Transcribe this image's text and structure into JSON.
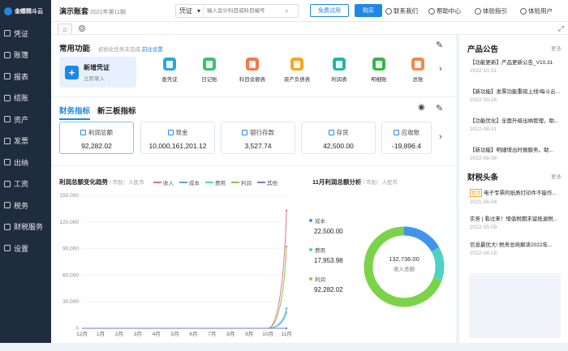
{
  "brand": {
    "name": "金蝶精斗云"
  },
  "sidebar": {
    "items": [
      {
        "label": "凭证",
        "icon": "voucher-icon"
      },
      {
        "label": "账簿",
        "icon": "ledger-icon"
      },
      {
        "label": "报表",
        "icon": "report-icon"
      },
      {
        "label": "结账",
        "icon": "closing-icon"
      },
      {
        "label": "资产",
        "icon": "asset-icon"
      },
      {
        "label": "发票",
        "icon": "invoice-icon"
      },
      {
        "label": "出纳",
        "icon": "cashier-icon"
      },
      {
        "label": "工资",
        "icon": "salary-icon"
      },
      {
        "label": "税务",
        "icon": "tax-icon"
      },
      {
        "label": "财税服务",
        "icon": "service-icon"
      },
      {
        "label": "设置",
        "icon": "settings-icon"
      }
    ]
  },
  "header": {
    "account": "演示账套",
    "period": "2021年第11期",
    "search_type": "凭证",
    "search_placeholder": "输入会计科目或科目编号",
    "trial_button": "免费试用",
    "buy_button": "购买",
    "contact": "联系我们",
    "help": "帮助中心",
    "guide": "体验指引",
    "user": "体验用户"
  },
  "tabs": {
    "home_icon": "⌂",
    "more": "⊙",
    "expand": "⤢"
  },
  "common": {
    "title": "常用功能",
    "hint": "初始化任务未完成,",
    "hint_link": "前往设置",
    "new_voucher": "新增凭证",
    "new_voucher_sub": "立即录入",
    "functions": [
      {
        "label": "查凭证",
        "color": "#2aa7d8"
      },
      {
        "label": "日记账",
        "color": "#3fbf6f"
      },
      {
        "label": "科目余额表",
        "color": "#ef7a4a"
      },
      {
        "label": "资产负债表",
        "color": "#f5a623"
      },
      {
        "label": "利润表",
        "color": "#26b3a6"
      },
      {
        "label": "明细账",
        "color": "#39b54a"
      },
      {
        "label": "总账",
        "color": "#f08a4b"
      }
    ]
  },
  "indicators": {
    "tab_active": "财务指标",
    "tab_other": "新三板指标",
    "metrics": [
      {
        "label": "利润总额",
        "value": "92,282.02"
      },
      {
        "label": "现金",
        "value": "10,000,161,201.12"
      },
      {
        "label": "银行存款",
        "value": "3,527.74"
      },
      {
        "label": "存货",
        "value": "42,500.00"
      },
      {
        "label": "应收账",
        "value": "-19,896.4"
      }
    ]
  },
  "trend": {
    "title": "利润总额变化趋势",
    "currency": "/ 币别：人民币"
  },
  "analysis": {
    "title": "11月利润总额分析",
    "currency": "/ 币别：人民币",
    "center_value": "132,736.00",
    "center_label": "收入总额"
  },
  "chart_data": [
    {
      "type": "line",
      "title": "利润总额变化趋势",
      "categories": [
        "12月",
        "1月",
        "2月",
        "3月",
        "4月",
        "5月",
        "6月",
        "7月",
        "8月",
        "9月",
        "10月",
        "11月"
      ],
      "ylim": [
        0,
        150000
      ],
      "yticks": [
        "0",
        "15,000",
        "30,000",
        "45,000",
        "60,000",
        "75,000",
        "90,000",
        "105,000",
        "120,000",
        "135,000",
        "150,000"
      ],
      "grid": true,
      "legend": "top",
      "series": [
        {
          "name": "收入",
          "color": "#e6708f",
          "values": [
            0,
            0,
            0,
            0,
            0,
            0,
            0,
            0,
            0,
            0,
            0,
            132736
          ]
        },
        {
          "name": "成本",
          "color": "#5fa6e8",
          "values": [
            0,
            0,
            0,
            0,
            0,
            0,
            0,
            0,
            0,
            0,
            0,
            22500
          ]
        },
        {
          "name": "费用",
          "color": "#4fd1c5",
          "values": [
            0,
            0,
            0,
            0,
            0,
            0,
            0,
            0,
            0,
            0,
            0,
            17953.98
          ]
        },
        {
          "name": "利润",
          "color": "#8bc34a",
          "values": [
            0,
            0,
            0,
            0,
            0,
            0,
            0,
            0,
            0,
            0,
            0,
            92282.02
          ]
        },
        {
          "name": "其他",
          "color": "#6b7fc4",
          "values": [
            0,
            0,
            0,
            0,
            0,
            0,
            0,
            0,
            0,
            0,
            0,
            0
          ]
        }
      ]
    },
    {
      "type": "pie",
      "title": "11月利润总额分析",
      "series": [
        {
          "name": "成本",
          "value": "22,500.00",
          "amount": 22500,
          "color": "#3f96e8"
        },
        {
          "name": "费用",
          "value": "17,953.98",
          "amount": 17953.98,
          "color": "#4fd1c5"
        },
        {
          "name": "利润",
          "value": "92,282.02",
          "amount": 92282.02,
          "color": "#7bd34a"
        }
      ]
    }
  ],
  "announcements": {
    "title": "产品公告",
    "more": "更多",
    "items": [
      {
        "text": "【功能更新】产品更新公告_V10.31",
        "date": "2022-10.31"
      },
      {
        "text": "【新功能】发票功能重磅上线!每斗云...",
        "date": "2022-09-26"
      },
      {
        "text": "【功能优化】全面升级出纳管理，助...",
        "date": "2022-08-31"
      },
      {
        "text": "【新功能】明細增出时报服务，助...",
        "date": "2022-08-08"
      }
    ]
  },
  "tax_news": {
    "title": "财税头条",
    "more": "更多",
    "items": [
      {
        "badge": "置顶",
        "text": "电子专票的纸质打印件不能作...",
        "date": "2021-06-04"
      },
      {
        "text": "实务 | 看过来！增值税期末留抵退税...",
        "date": "2022-05-09"
      },
      {
        "text": "信息最优大! 税务总局解读2022年...",
        "date": "2022-04-15"
      }
    ]
  }
}
